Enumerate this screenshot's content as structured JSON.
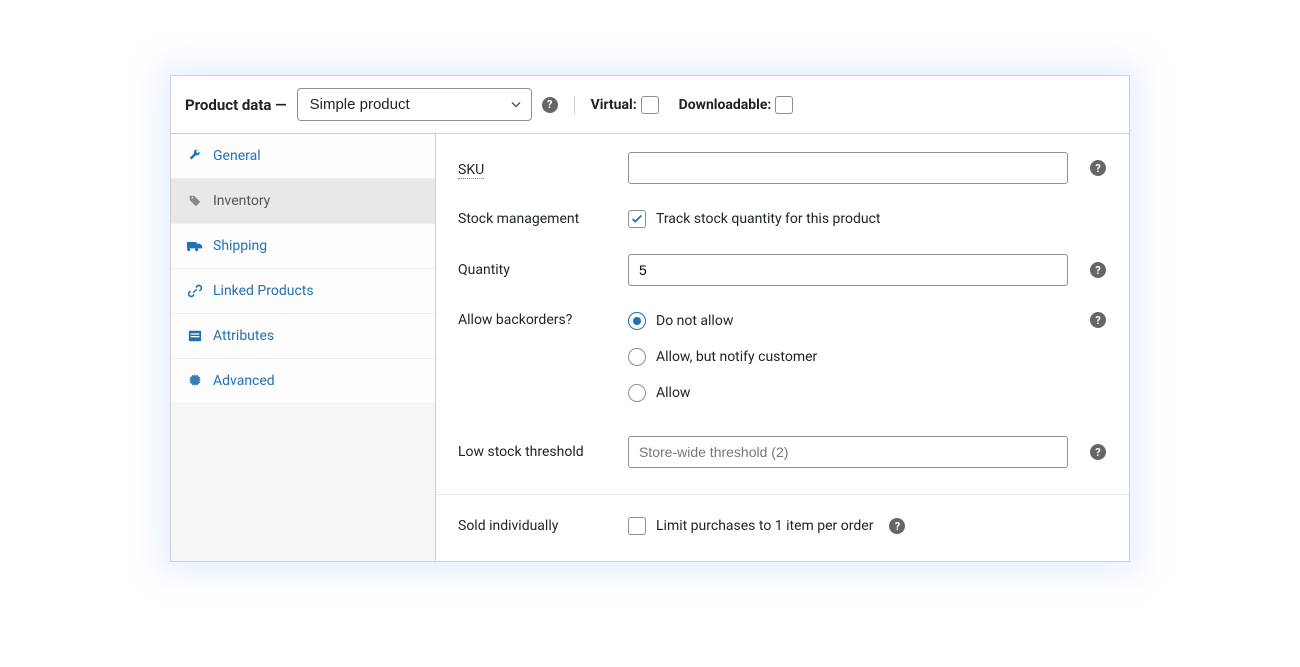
{
  "header": {
    "title": "Product data —",
    "product_type": "Simple product",
    "virtual_label": "Virtual:",
    "downloadable_label": "Downloadable:",
    "virtual_checked": false,
    "downloadable_checked": false
  },
  "sidebar": {
    "items": [
      {
        "label": "General",
        "icon": "wrench"
      },
      {
        "label": "Inventory",
        "icon": "tag",
        "active": true
      },
      {
        "label": "Shipping",
        "icon": "truck"
      },
      {
        "label": "Linked Products",
        "icon": "link"
      },
      {
        "label": "Attributes",
        "icon": "list"
      },
      {
        "label": "Advanced",
        "icon": "gear"
      }
    ]
  },
  "form": {
    "sku_label": "SKU",
    "sku_value": "",
    "stock_mgmt_label": "Stock management",
    "stock_mgmt_checkbox_label": "Track stock quantity for this product",
    "stock_mgmt_checked": true,
    "quantity_label": "Quantity",
    "quantity_value": "5",
    "backorders_label": "Allow backorders?",
    "backorders_options": [
      {
        "label": "Do not allow",
        "checked": true
      },
      {
        "label": "Allow, but notify customer",
        "checked": false
      },
      {
        "label": "Allow",
        "checked": false
      }
    ],
    "low_stock_label": "Low stock threshold",
    "low_stock_placeholder": "Store-wide threshold (2)",
    "low_stock_value": "",
    "sold_individually_label": "Sold individually",
    "sold_individually_checkbox_label": "Limit purchases to 1 item per order",
    "sold_individually_checked": false
  }
}
